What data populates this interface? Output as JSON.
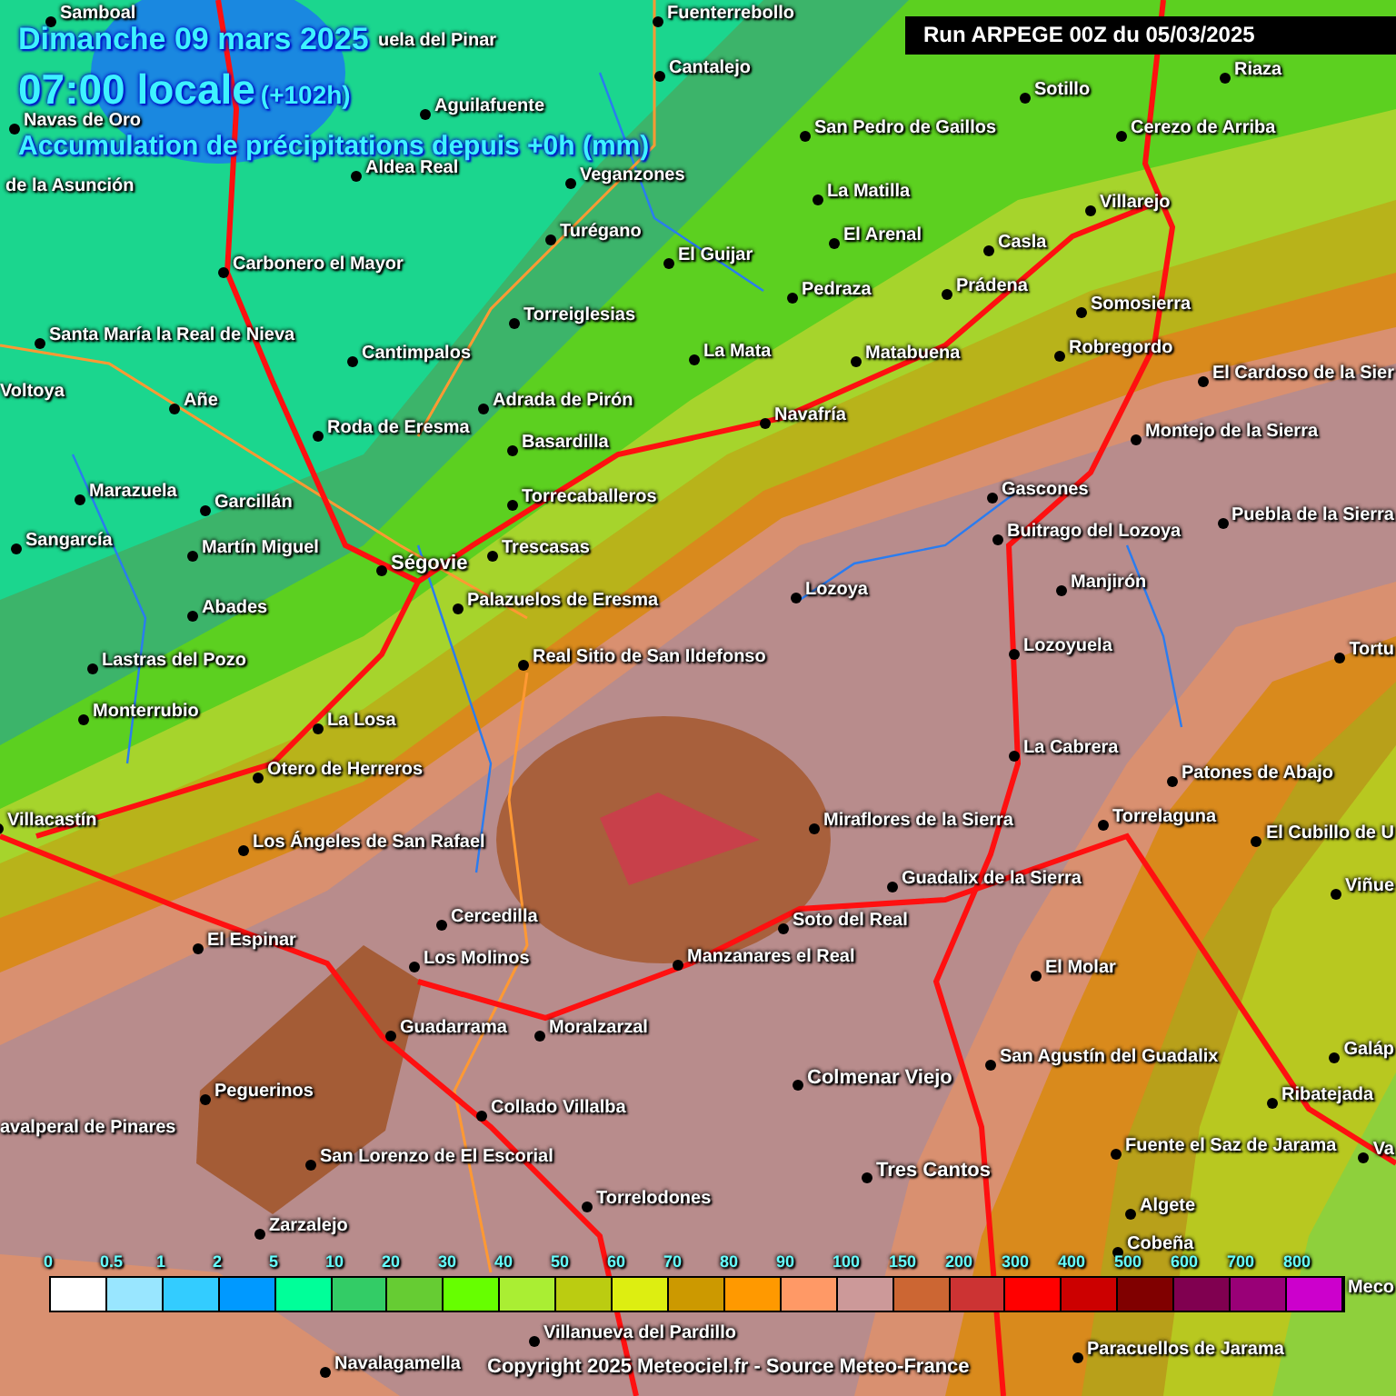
{
  "header": {
    "date": "Dimanche 09 mars 2025",
    "time": "07:00 locale",
    "lead_time": "(+102h)",
    "subtitle": "Accumulation de précipitations depuis +0h (mm)"
  },
  "run_label": "Run ARPEGE 00Z du 05/03/2025",
  "towns": [
    {
      "name": "Samboal",
      "kind": "town"
    },
    {
      "name": "Fuenterrebollo",
      "kind": "town"
    },
    {
      "name": "uela del Pinar",
      "kind": "town"
    },
    {
      "name": "Cantalejo",
      "kind": "town"
    },
    {
      "name": "Riaza",
      "kind": "town"
    },
    {
      "name": "Sotillo",
      "kind": "town"
    },
    {
      "name": "Aguilafuente",
      "kind": "town"
    },
    {
      "name": "Navas de Oro",
      "kind": "town"
    },
    {
      "name": "San Pedro de Gaillos",
      "kind": "town"
    },
    {
      "name": "Cerezo de Arriba",
      "kind": "town"
    },
    {
      "name": "de la Asunción",
      "kind": "town"
    },
    {
      "name": "Aldea Real",
      "kind": "town"
    },
    {
      "name": "Veganzones",
      "kind": "town"
    },
    {
      "name": "La Matilla",
      "kind": "town"
    },
    {
      "name": "Villarejo",
      "kind": "town"
    },
    {
      "name": "Turégano",
      "kind": "town"
    },
    {
      "name": "El Arenal",
      "kind": "town"
    },
    {
      "name": "Casla",
      "kind": "town"
    },
    {
      "name": "Carbonero el Mayor",
      "kind": "town"
    },
    {
      "name": "El Guijar",
      "kind": "town"
    },
    {
      "name": "Pedraza",
      "kind": "town"
    },
    {
      "name": "Prádena",
      "kind": "town"
    },
    {
      "name": "Torreiglesias",
      "kind": "town"
    },
    {
      "name": "Somosierra",
      "kind": "town"
    },
    {
      "name": "Santa María la Real de Nieva",
      "kind": "town"
    },
    {
      "name": "Cantimpalos",
      "kind": "town"
    },
    {
      "name": "La Mata",
      "kind": "town"
    },
    {
      "name": "Matabuena",
      "kind": "town"
    },
    {
      "name": "Robregordo",
      "kind": "town"
    },
    {
      "name": "El Cardoso de la Sier",
      "kind": "town"
    },
    {
      "name": "Voltoya",
      "kind": "town"
    },
    {
      "name": "Añe",
      "kind": "town"
    },
    {
      "name": "Adrada de Pirón",
      "kind": "town"
    },
    {
      "name": "Roda de Eresma",
      "kind": "town"
    },
    {
      "name": "Navafría",
      "kind": "town"
    },
    {
      "name": "Basardilla",
      "kind": "town"
    },
    {
      "name": "Montejo de la Sierra",
      "kind": "town"
    },
    {
      "name": "Marazuela",
      "kind": "town"
    },
    {
      "name": "Garcillán",
      "kind": "town"
    },
    {
      "name": "Torrecaballeros",
      "kind": "town"
    },
    {
      "name": "Gascones",
      "kind": "town"
    },
    {
      "name": "Puebla de la Sierra",
      "kind": "town"
    },
    {
      "name": "Sangarcía",
      "kind": "town"
    },
    {
      "name": "Martín Miguel",
      "kind": "town"
    },
    {
      "name": "Trescasas",
      "kind": "town"
    },
    {
      "name": "Buitrago del Lozoya",
      "kind": "town"
    },
    {
      "name": "Ségovie",
      "kind": "city"
    },
    {
      "name": "Abades",
      "kind": "town"
    },
    {
      "name": "Palazuelos de Eresma",
      "kind": "town"
    },
    {
      "name": "Lozoya",
      "kind": "town"
    },
    {
      "name": "Manjirón",
      "kind": "town"
    },
    {
      "name": "Lastras del Pozo",
      "kind": "town"
    },
    {
      "name": "Real Sitio de San Ildefonso",
      "kind": "town"
    },
    {
      "name": "Lozoyuela",
      "kind": "town"
    },
    {
      "name": "Tortu",
      "kind": "town"
    },
    {
      "name": "Monterrubio",
      "kind": "town"
    },
    {
      "name": "La Losa",
      "kind": "town"
    },
    {
      "name": "La Cabrera",
      "kind": "town"
    },
    {
      "name": "Otero de Herreros",
      "kind": "town"
    },
    {
      "name": "Patones de Abajo",
      "kind": "town"
    },
    {
      "name": "Villacastín",
      "kind": "town"
    },
    {
      "name": "Miraflores de la Sierra",
      "kind": "town"
    },
    {
      "name": "Torrelaguna",
      "kind": "town"
    },
    {
      "name": "Los Ángeles de San Rafael",
      "kind": "town"
    },
    {
      "name": "El Cubillo de U",
      "kind": "town"
    },
    {
      "name": "Guadalix de la Sierra",
      "kind": "town"
    },
    {
      "name": "Viñue",
      "kind": "town"
    },
    {
      "name": "Cercedilla",
      "kind": "town"
    },
    {
      "name": "Soto del Real",
      "kind": "town"
    },
    {
      "name": "El Espinar",
      "kind": "town"
    },
    {
      "name": "Los Molinos",
      "kind": "town"
    },
    {
      "name": "Manzanares el Real",
      "kind": "town"
    },
    {
      "name": "El Molar",
      "kind": "town"
    },
    {
      "name": "Guadarrama",
      "kind": "town"
    },
    {
      "name": "Moralzarzal",
      "kind": "town"
    },
    {
      "name": "San Agustín del Guadalix",
      "kind": "town"
    },
    {
      "name": "Galáp",
      "kind": "town"
    },
    {
      "name": "Peguerinos",
      "kind": "town"
    },
    {
      "name": "Colmenar Viejo",
      "kind": "city"
    },
    {
      "name": "Collado Villalba",
      "kind": "town"
    },
    {
      "name": "Ribatejada",
      "kind": "town"
    },
    {
      "name": "avalperal de Pinares",
      "kind": "town"
    },
    {
      "name": "San Lorenzo de El Escorial",
      "kind": "town"
    },
    {
      "name": "Fuente el Saz de Jarama",
      "kind": "town"
    },
    {
      "name": "Tres Cantos",
      "kind": "city"
    },
    {
      "name": "Va",
      "kind": "town"
    },
    {
      "name": "Torrelodones",
      "kind": "town"
    },
    {
      "name": "Algete",
      "kind": "town"
    },
    {
      "name": "Zarzalejo",
      "kind": "town"
    },
    {
      "name": "Cobeña",
      "kind": "town"
    },
    {
      "name": "Meco",
      "kind": "town"
    },
    {
      "name": "Villanueva del Pardillo",
      "kind": "town"
    },
    {
      "name": "Navalagamella",
      "kind": "town"
    },
    {
      "name": "Paracuellos de Jarama",
      "kind": "town"
    }
  ],
  "legend": {
    "labels": [
      "0",
      "0.5",
      "1",
      "2",
      "5",
      "10",
      "20",
      "30",
      "40",
      "50",
      "60",
      "70",
      "80",
      "90",
      "100",
      "150",
      "200",
      "300",
      "400",
      "500",
      "600",
      "700",
      "800"
    ],
    "bins": [
      {
        "color": "#ffffff"
      },
      {
        "color": "#99e6ff"
      },
      {
        "color": "#33ccff"
      },
      {
        "color": "#0099ff"
      },
      {
        "color": "#00ff99"
      },
      {
        "color": "#33cc66"
      },
      {
        "color": "#66cc33"
      },
      {
        "color": "#66ff00"
      },
      {
        "color": "#aaee33"
      },
      {
        "color": "#bbcc11"
      },
      {
        "color": "#ddee11"
      },
      {
        "color": "#cc9900"
      },
      {
        "color": "#ff9900"
      },
      {
        "color": "#ff9966"
      },
      {
        "color": "#cc9999"
      },
      {
        "color": "#cc6633"
      },
      {
        "color": "#cc3333"
      },
      {
        "color": "#ff0000"
      },
      {
        "color": "#cc0000"
      },
      {
        "color": "#800000"
      },
      {
        "color": "#800050"
      },
      {
        "color": "#990077"
      },
      {
        "color": "#cc00cc"
      }
    ]
  },
  "copyright": "Copyright 2025 Meteociel.fr - Source Meteo-France"
}
